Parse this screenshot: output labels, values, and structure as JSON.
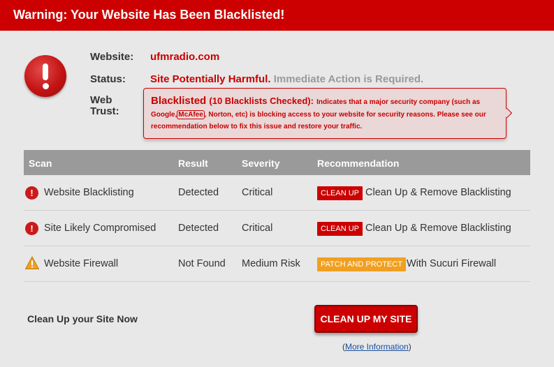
{
  "header": {
    "title": "Warning: Your Website Has Been Blacklisted!"
  },
  "info": {
    "website_label": "Website:",
    "website_value": "ufmradio.com",
    "status_label": "Status:",
    "status_harmful": "Site Potentially Harmful.",
    "status_action": "Immediate Action is Required.",
    "trust_label_1": "Web",
    "trust_label_2": "Trust:"
  },
  "trust_box": {
    "headline": "Blacklisted",
    "checked": "(10 Blacklists Checked):",
    "intro": "Indicates that a major security company (such as",
    "google": "Google,",
    "mcafee": "McAfee",
    "rest_line2": ", Norton, etc) is blocking access to your website for security reasons. Please see our",
    "line3": "recommendation below to fix this issue and restore your traffic."
  },
  "table": {
    "headers": {
      "scan": "Scan",
      "result": "Result",
      "severity": "Severity",
      "recommendation": "Recommendation"
    },
    "rows": [
      {
        "icon": "error-icon",
        "scan": "Website Blacklisting",
        "result": "Detected",
        "severity": "Critical",
        "tag": "CLEAN UP",
        "tag_color": "#cc0000",
        "rec": "Clean Up & Remove Blacklisting"
      },
      {
        "icon": "error-icon",
        "scan": "Site Likely Compromised",
        "result": "Detected",
        "severity": "Critical",
        "tag": "CLEAN UP",
        "tag_color": "#cc0000",
        "rec": "Clean Up & Remove Blacklisting"
      },
      {
        "icon": "warning-icon",
        "scan": "Website Firewall",
        "result": "Not Found",
        "severity": "Medium Risk",
        "tag": "PATCH AND PROTECT",
        "tag_color": "#f0a020",
        "rec": "With Sucuri Firewall"
      }
    ]
  },
  "cta": {
    "label": "Clean Up your Site Now",
    "button": "CLEAN UP MY SITE",
    "more_open": "(",
    "more_link": "More Information",
    "more_close": ")"
  }
}
